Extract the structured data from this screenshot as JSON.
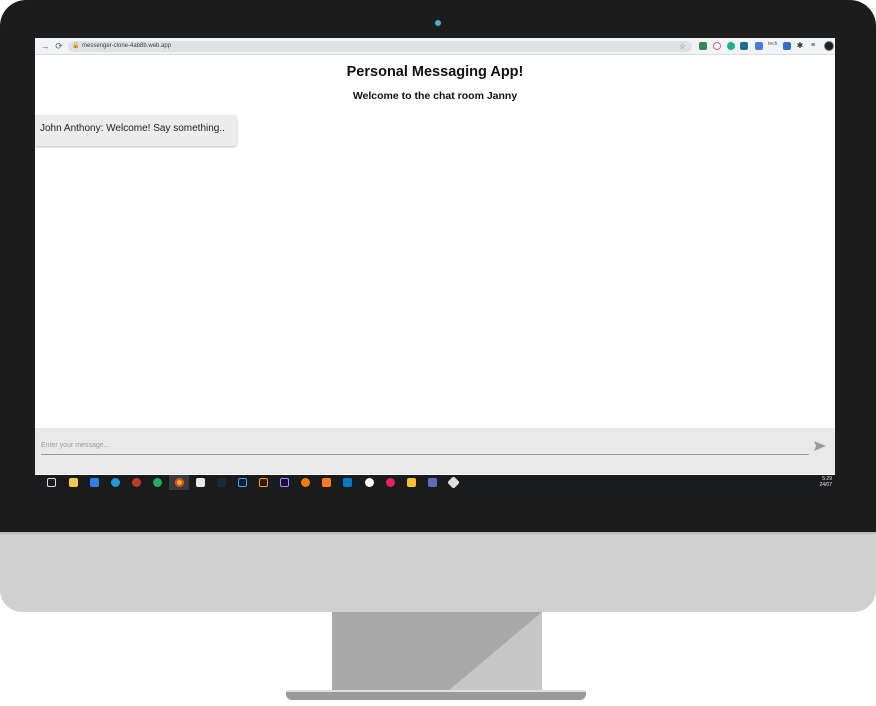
{
  "browser": {
    "url": "messenger-clone-4ab8b.web.app",
    "ext_text": "tech"
  },
  "app": {
    "title": "Personal Messaging App!",
    "subtitle": "Welcome to the chat room Janny"
  },
  "messages": [
    {
      "text": "John Anthony: Welcome! Say something.."
    }
  ],
  "composer": {
    "placeholder": "Enter your message..."
  },
  "taskbar": {
    "time": "5:29",
    "date": "24/07"
  },
  "colors": {
    "bezel": "#1c1c1c",
    "composer_bg": "#e9e9ea",
    "message_bg": "#ececec",
    "taskbar_bg": "#1a1b1d"
  }
}
